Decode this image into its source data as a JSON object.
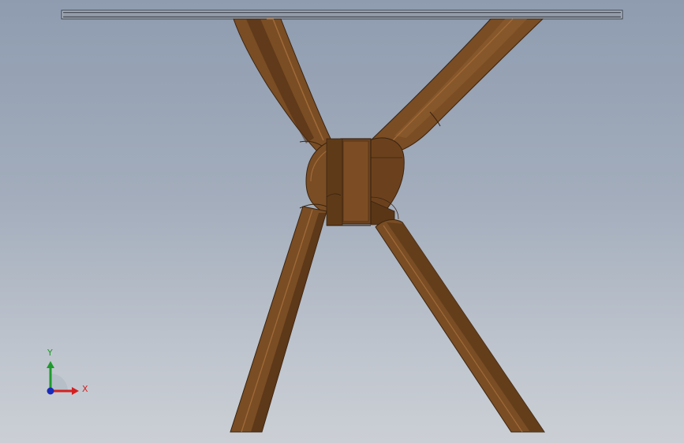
{
  "viewport": {
    "background_top": "#8f9cb0",
    "background_bottom": "#cbcfd5"
  },
  "model": {
    "leg_color": "#7a4d24",
    "leg_shadow_color": "#4a2c12",
    "leg_highlight_color": "#a06a38",
    "top_edge_color": "#3e4550"
  },
  "triad": {
    "x_label": "X",
    "y_label": "Y",
    "x_color": "#d42020",
    "y_color": "#1e9a2c",
    "z_color": "#1a2bb8"
  }
}
